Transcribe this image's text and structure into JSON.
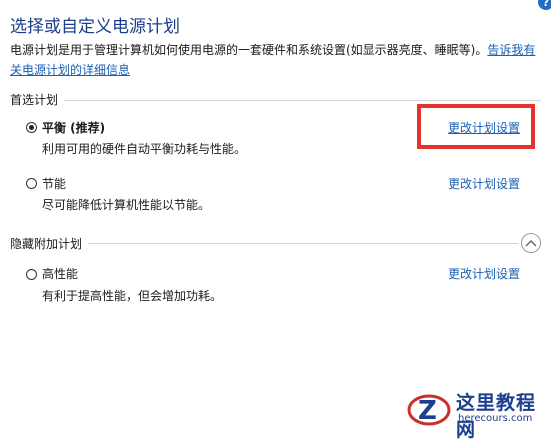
{
  "header": {
    "title": "选择或自定义电源计划",
    "intro_text": "电源计划是用于管理计算机如何使用电源的一套硬件和系统设置(如显示器亮度、睡眠等)。",
    "intro_link": "告诉我有关电源计划的详细信息"
  },
  "preferred": {
    "group_label": "首选计划",
    "plans": [
      {
        "name": "平衡 (推荐)",
        "description": "利用可用的硬件自动平衡功耗与性能。",
        "link": "更改计划设置",
        "selected": true
      },
      {
        "name": "节能",
        "description": "尽可能降低计算机性能以节能。",
        "link": "更改计划设置",
        "selected": false
      }
    ]
  },
  "hidden": {
    "group_label": "隐藏附加计划",
    "plans": [
      {
        "name": "高性能",
        "description": "有利于提高性能，但会增加功耗。",
        "link": "更改计划设置",
        "selected": false
      }
    ]
  },
  "watermark": {
    "name": "这里教程网",
    "domain": "herecours.com"
  },
  "colors": {
    "title": "#1e3c8c",
    "link": "#1a5fb4",
    "highlight": "#e8342f"
  }
}
